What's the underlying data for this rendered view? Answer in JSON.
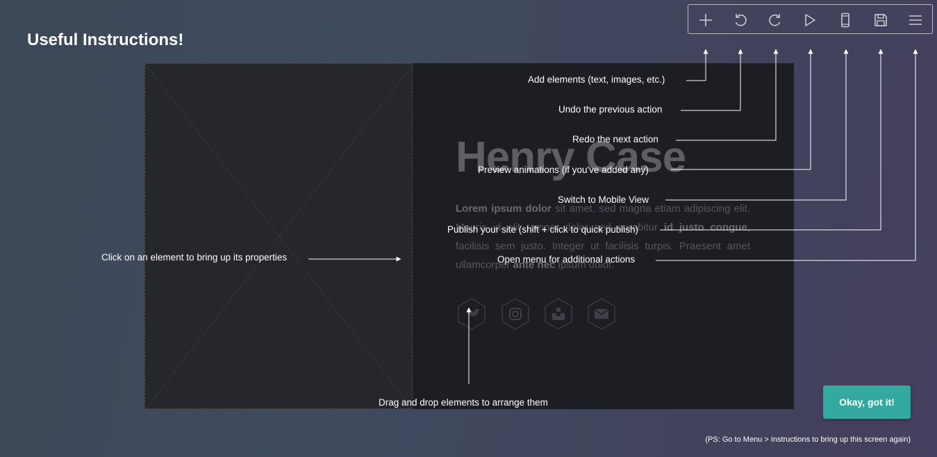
{
  "title": "Useful Instructions!",
  "site": {
    "name": "Henry Case",
    "text_parts": [
      {
        "text": "Lorem ipsum dolor",
        "bold": true
      },
      {
        "text": " sit amet, sed magna etiam adipiscing elit. Mauris id elit tempor dolor sed curabitur ",
        "bold": false
      },
      {
        "text": "id justo congue",
        "bold": true
      },
      {
        "text": ", facilisis sem justo. Integer ut facilisis turpis. Praesent amet ullamcorper ",
        "bold": false
      },
      {
        "text": "ante nec",
        "bold": true
      },
      {
        "text": " ipsum dolor.",
        "bold": false
      }
    ],
    "social_icons": [
      "twitter-icon",
      "instagram-icon",
      "unsplash-icon",
      "email-icon"
    ]
  },
  "toolbar": {
    "items": [
      {
        "name": "add",
        "icon": "plus-icon"
      },
      {
        "name": "undo",
        "icon": "undo-icon"
      },
      {
        "name": "redo",
        "icon": "redo-icon"
      },
      {
        "name": "preview",
        "icon": "play-icon"
      },
      {
        "name": "mobile",
        "icon": "mobile-icon"
      },
      {
        "name": "publish",
        "icon": "save-icon"
      },
      {
        "name": "menu",
        "icon": "menu-icon"
      }
    ]
  },
  "instructions": {
    "add": "Add elements (text, images, etc.)",
    "undo": "Undo the previous action",
    "redo": "Redo the next action",
    "preview": "Preview animations (if you've added any)",
    "mobile": "Switch to Mobile View",
    "publish": "Publish your site (shift + click to quick publish)",
    "menu": "Open menu for additional actions",
    "properties": "Click on an element to bring up its properties",
    "drag": "Drag and drop elements to arrange them"
  },
  "ok_button": "Okay, got it!",
  "ps_note": "(PS: Go to Menu > Instructions to bring up this screen again)",
  "colors": {
    "accent": "#33a9a0",
    "background": "#3f4a5e",
    "site_background": "#1d1e23"
  }
}
